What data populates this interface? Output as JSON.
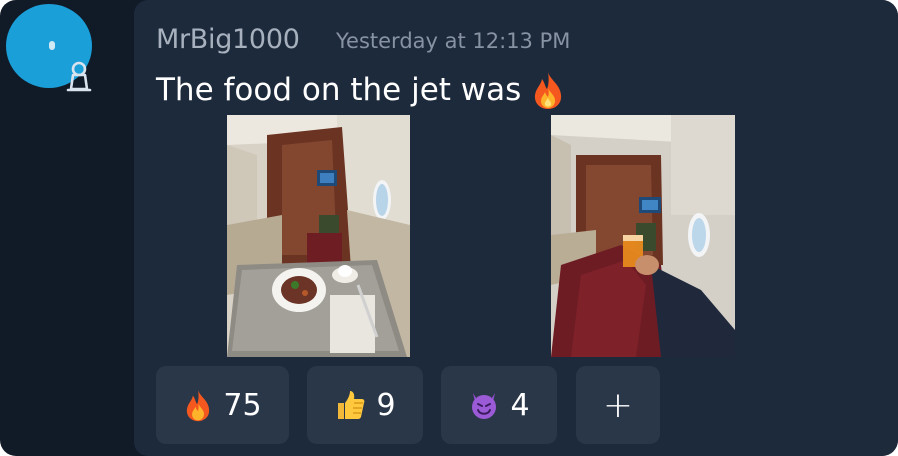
{
  "message": {
    "username": "MrBig1000",
    "timestamp": "Yesterday at 12:13 PM",
    "text": "The food on the jet was",
    "text_emoji": "fire",
    "attachments": [
      {
        "subject": "private jet interior, plate of food on tray table"
      },
      {
        "subject": "private jet interior, hand holding orange juice glass"
      }
    ]
  },
  "reactions": [
    {
      "emoji": "fire",
      "count": "75"
    },
    {
      "emoji": "thumbs-up",
      "count": "9"
    },
    {
      "emoji": "smiling-devil",
      "count": "4"
    }
  ],
  "add_reaction_label": "+",
  "colors": {
    "app_bg": "#111a27",
    "card_bg": "#1d2a3c",
    "reaction_bg": "#2a3749",
    "avatar_bg": "#1a9fd9",
    "username": "#a7b1be",
    "timestamp": "#8793a2"
  }
}
